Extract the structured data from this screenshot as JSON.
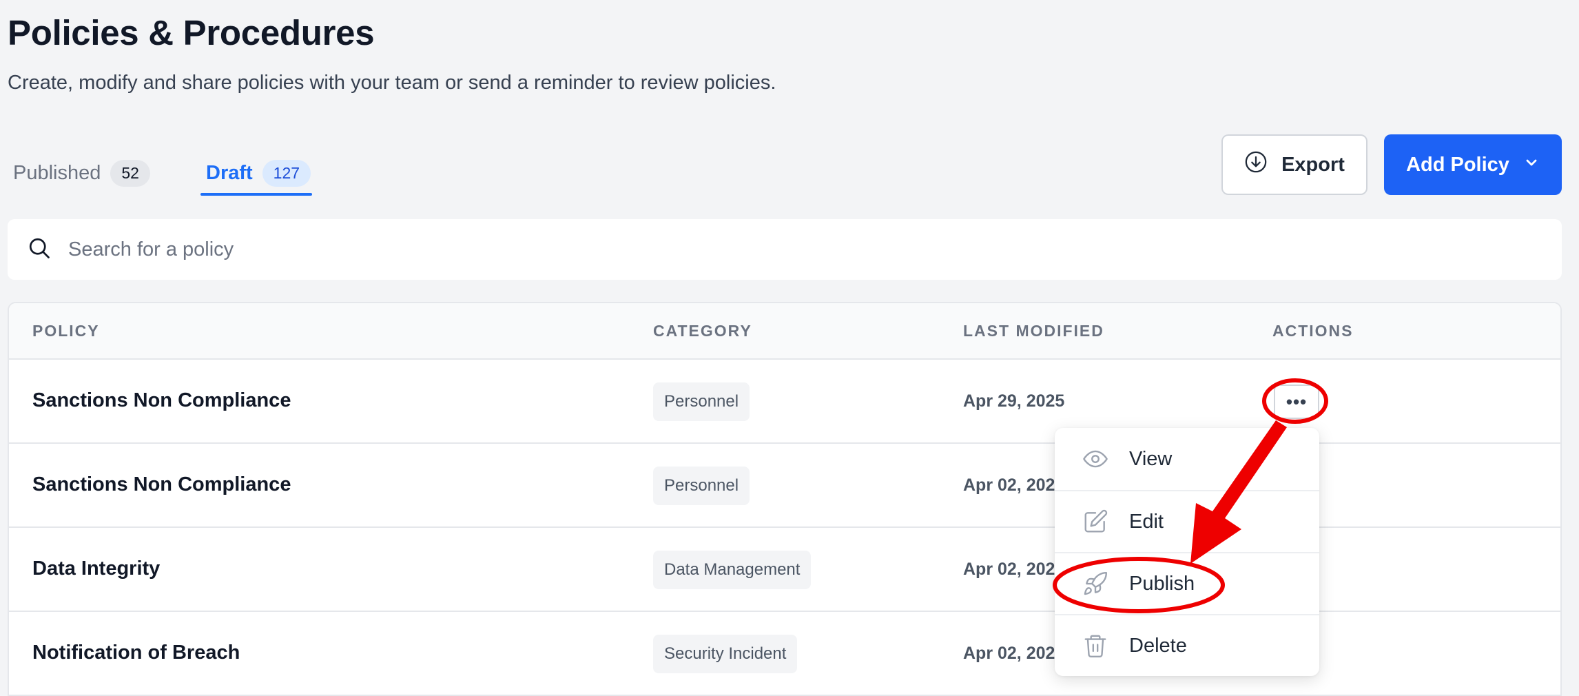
{
  "header": {
    "title": "Policies & Procedures",
    "subtitle": "Create, modify and share policies with your team or send a reminder to review policies."
  },
  "tabs": [
    {
      "label": "Published",
      "count": "52",
      "active": false
    },
    {
      "label": "Draft",
      "count": "127",
      "active": true
    }
  ],
  "toolbar": {
    "export_label": "Export",
    "add_policy_label": "Add Policy"
  },
  "search": {
    "placeholder": "Search for a policy",
    "value": ""
  },
  "table": {
    "columns": [
      "POLICY",
      "CATEGORY",
      "LAST MODIFIED",
      "ACTIONS"
    ],
    "rows": [
      {
        "policy": "Sanctions Non Compliance",
        "category": "Personnel",
        "last_modified": "Apr 29, 2025"
      },
      {
        "policy": "Sanctions Non Compliance",
        "category": "Personnel",
        "last_modified": "Apr 02, 2025"
      },
      {
        "policy": "Data Integrity",
        "category": "Data Management",
        "last_modified": "Apr 02, 2025"
      },
      {
        "policy": "Notification of Breach",
        "category": "Security Incident",
        "last_modified": "Apr 02, 2025"
      }
    ]
  },
  "actions_menu": {
    "trigger_glyph": "•••",
    "items": [
      {
        "label": "View",
        "icon": "eye-icon"
      },
      {
        "label": "Edit",
        "icon": "pencil-square-icon"
      },
      {
        "label": "Publish",
        "icon": "rocket-icon"
      },
      {
        "label": "Delete",
        "icon": "trash-icon"
      }
    ]
  },
  "colors": {
    "primary": "#1d62f5",
    "active_tab": "#1d6ef7",
    "annotation": "#ee0000",
    "background": "#f3f4f6"
  }
}
